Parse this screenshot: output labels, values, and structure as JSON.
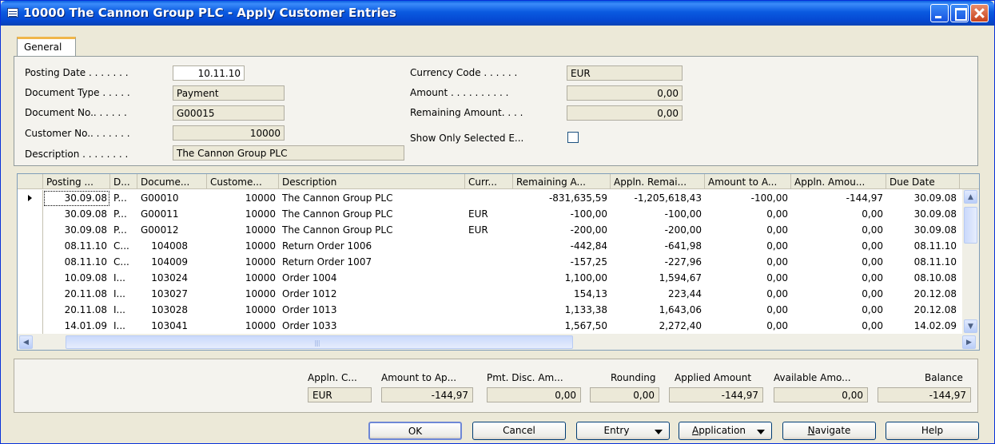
{
  "window": {
    "title": "10000 The Cannon Group PLC - Apply Customer Entries"
  },
  "tab": {
    "label": "General"
  },
  "general": {
    "posting_date_label": "Posting Date . . . . . . .",
    "posting_date": "10.11.10",
    "document_type_label": "Document Type . . . . .",
    "document_type": "Payment",
    "document_no_label": "Document No.. . . . . .",
    "document_no": "G00015",
    "customer_no_label": "Customer No.. . . . . . .",
    "customer_no": "10000",
    "description_label": "Description . . . . . . . .",
    "description": "The Cannon Group PLC",
    "currency_code_label": "Currency Code . . . . . .",
    "currency_code": "EUR",
    "amount_label": "Amount . . . . . . . . . .",
    "amount": "0,00",
    "remaining_amount_label": "Remaining Amount. . . .",
    "remaining_amount": "0,00",
    "show_only_label": "Show Only Selected E...",
    "show_only_checked": false
  },
  "grid": {
    "headers": [
      "Posting ...",
      "D...",
      "Docume...",
      "Custome...",
      "Description",
      "Curr...",
      "Remaining A...",
      "Appln. Remai...",
      "Amount to A...",
      "Appln. Amou...",
      "Due Date"
    ],
    "rows": [
      [
        "30.09.08",
        "P...",
        "G00010",
        "10000",
        "The Cannon Group PLC",
        "",
        "-831,635,59",
        "-1,205,618,43",
        "-100,00",
        "-144,97",
        "30.09.08"
      ],
      [
        "30.09.08",
        "P...",
        "G00011",
        "10000",
        "The Cannon Group PLC",
        "EUR",
        "-100,00",
        "-100,00",
        "0,00",
        "0,00",
        "30.09.08"
      ],
      [
        "30.09.08",
        "P...",
        "G00012",
        "10000",
        "The Cannon Group PLC",
        "EUR",
        "-200,00",
        "-200,00",
        "0,00",
        "0,00",
        "30.09.08"
      ],
      [
        "08.11.10",
        "C...",
        "104008",
        "10000",
        "Return Order 1006",
        "",
        "-442,84",
        "-641,98",
        "0,00",
        "0,00",
        "08.11.10"
      ],
      [
        "08.11.10",
        "C...",
        "104009",
        "10000",
        "Return Order 1007",
        "",
        "-157,25",
        "-227,96",
        "0,00",
        "0,00",
        "08.11.10"
      ],
      [
        "10.09.08",
        "I...",
        "103024",
        "10000",
        "Order 1004",
        "",
        "1,100,00",
        "1,594,67",
        "0,00",
        "0,00",
        "08.10.08"
      ],
      [
        "20.11.08",
        "I...",
        "103027",
        "10000",
        "Order 1012",
        "",
        "154,13",
        "223,44",
        "0,00",
        "0,00",
        "20.12.08"
      ],
      [
        "20.11.08",
        "I...",
        "103028",
        "10000",
        "Order 1013",
        "",
        "1,133,38",
        "1,643,06",
        "0,00",
        "0,00",
        "20.12.08"
      ],
      [
        "14.01.09",
        "I...",
        "103041",
        "10000",
        "Order 1033",
        "",
        "1,567,50",
        "2,272,40",
        "0,00",
        "0,00",
        "14.02.09"
      ]
    ]
  },
  "summary": {
    "labels": [
      "Appln. C...",
      "Amount to Ap...",
      "Pmt. Disc. Am...",
      "Rounding",
      "Applied Amount",
      "Available Amo...",
      "Balance"
    ],
    "values": [
      "EUR",
      "-144,97",
      "0,00",
      "0,00",
      "-144,97",
      "0,00",
      "-144,97"
    ]
  },
  "buttons": {
    "ok": "OK",
    "cancel": "Cancel",
    "entry": "Entry",
    "application_first": "A",
    "application_rest": "pplication",
    "navigate_first": "N",
    "navigate_rest": "avigate",
    "help": "Help"
  },
  "colors": {
    "titlebar": "#0a5ae0",
    "window_bg": "#ece9d8",
    "tab_accent": "#f0b64a"
  }
}
